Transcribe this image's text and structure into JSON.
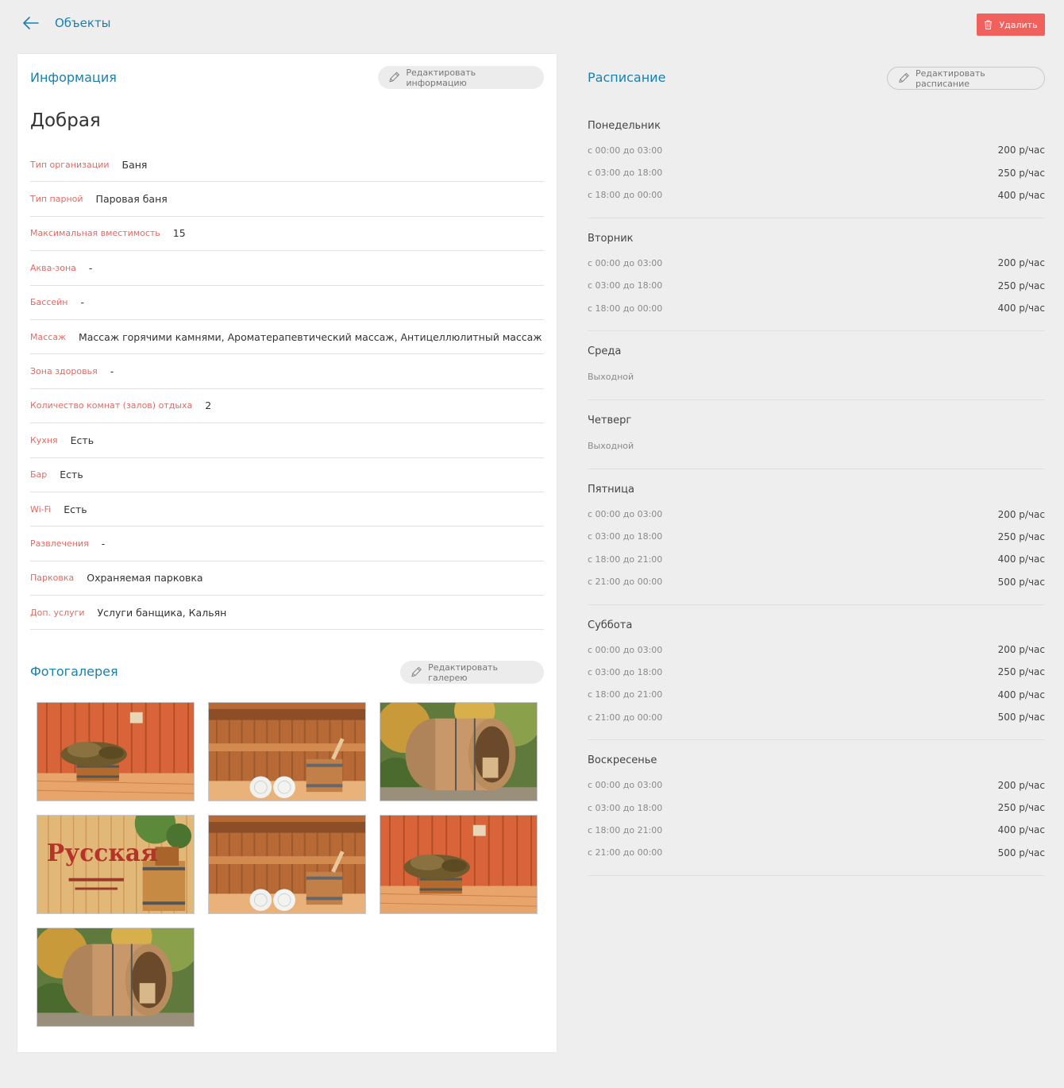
{
  "header": {
    "back_label": "Объекты",
    "delete_label": "Удалить"
  },
  "info": {
    "title": "Информация",
    "edit_label": "Редактировать информацию",
    "name": "Добрая",
    "rows": [
      {
        "label": "Тип организации",
        "value": "Баня"
      },
      {
        "label": "Тип парной",
        "value": "Паровая баня"
      },
      {
        "label": "Максимальная вместимость",
        "value": "15"
      },
      {
        "label": "Аква-зона",
        "value": "-"
      },
      {
        "label": "Бассейн",
        "value": "-"
      },
      {
        "label": "Массаж",
        "value": "Массаж горячими камнями, Ароматерапевтический массаж, Антицеллюлитный массаж"
      },
      {
        "label": "Зона здоровья",
        "value": "-"
      },
      {
        "label": "Количество комнат (залов) отдыха",
        "value": "2"
      },
      {
        "label": "Кухня",
        "value": "Есть"
      },
      {
        "label": "Бар",
        "value": "Есть"
      },
      {
        "label": "Wi-Fi",
        "value": "Есть"
      },
      {
        "label": "Развлечения",
        "value": "-"
      },
      {
        "label": "Парковка",
        "value": "Охраняемая парковка"
      },
      {
        "label": "Доп. услуги",
        "value": "Услуги банщика, Кальян"
      }
    ]
  },
  "gallery": {
    "title": "Фотогалерея",
    "edit_label": "Редактировать галерею",
    "photos": [
      "broom-tub-photo",
      "towels-bucket-photo",
      "barrel-sauna-photo",
      "russkaya-banya-sign-photo",
      "towels-bucket-photo",
      "broom-tub-photo",
      "barrel-sauna-photo"
    ],
    "sign_text": "Русская"
  },
  "schedule": {
    "title": "Расписание",
    "edit_label": "Редактировать расписание",
    "days": [
      {
        "name": "Понедельник",
        "off": "",
        "slots": [
          {
            "time": "с 00:00 до 03:00",
            "price": "200 р/час"
          },
          {
            "time": "с 03:00 до 18:00",
            "price": "250 р/час"
          },
          {
            "time": "с 18:00 до 00:00",
            "price": "400 р/час"
          }
        ]
      },
      {
        "name": "Вторник",
        "off": "",
        "slots": [
          {
            "time": "с 00:00 до 03:00",
            "price": "200 р/час"
          },
          {
            "time": "с 03:00 до 18:00",
            "price": "250 р/час"
          },
          {
            "time": "с 18:00 до 00:00",
            "price": "400 р/час"
          }
        ]
      },
      {
        "name": "Среда",
        "off": "Выходной",
        "slots": []
      },
      {
        "name": "Четверг",
        "off": "Выходной",
        "slots": []
      },
      {
        "name": "Пятница",
        "off": "",
        "slots": [
          {
            "time": "с 00:00 до 03:00",
            "price": "200 р/час"
          },
          {
            "time": "с 03:00 до 18:00",
            "price": "250 р/час"
          },
          {
            "time": "с 18:00 до 21:00",
            "price": "400 р/час"
          },
          {
            "time": "с 21:00 до 00:00",
            "price": "500 р/час"
          }
        ]
      },
      {
        "name": "Суббота",
        "off": "",
        "slots": [
          {
            "time": "с 00:00 до 03:00",
            "price": "200 р/час"
          },
          {
            "time": "с 03:00 до 18:00",
            "price": "250 р/час"
          },
          {
            "time": "с 18:00 до 21:00",
            "price": "400 р/час"
          },
          {
            "time": "с 21:00 до 00:00",
            "price": "500 р/час"
          }
        ]
      },
      {
        "name": "Воскресенье",
        "off": "",
        "slots": [
          {
            "time": "с 00:00 до 03:00",
            "price": "200 р/час"
          },
          {
            "time": "с 03:00 до 18:00",
            "price": "250 р/час"
          },
          {
            "time": "с 18:00 до 21:00",
            "price": "400 р/час"
          },
          {
            "time": "с 21:00 до 00:00",
            "price": "500 р/час"
          }
        ]
      }
    ]
  },
  "colors": {
    "accent": "#1a7fb0",
    "danger": "#f0605d",
    "label": "#e06b66"
  }
}
